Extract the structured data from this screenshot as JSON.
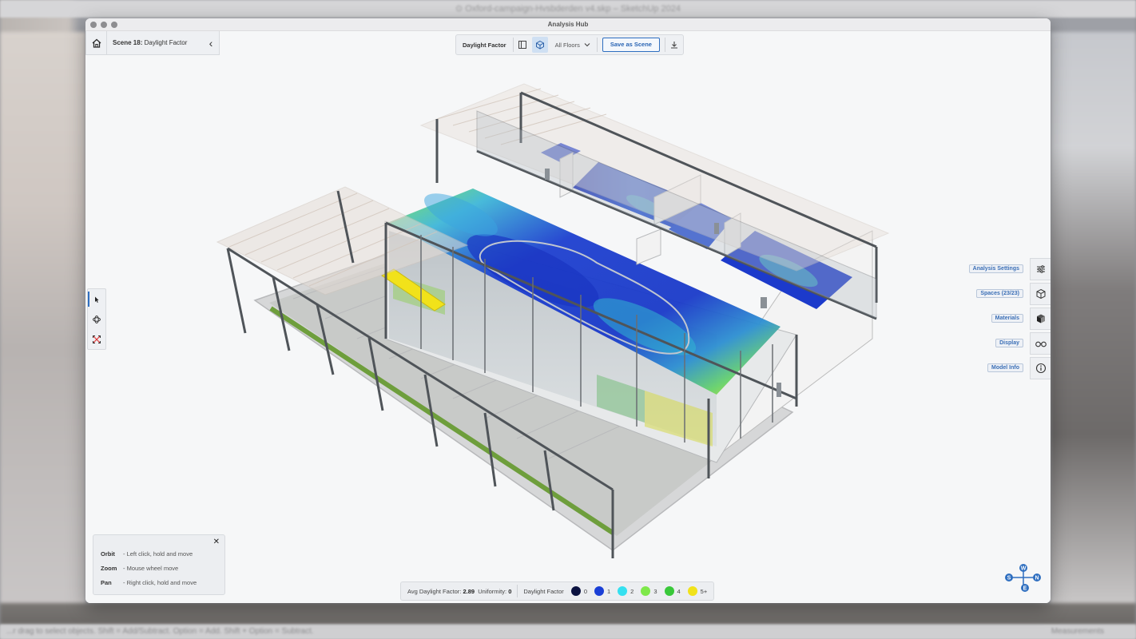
{
  "host": {
    "title": "⊙ Oxford-campaign-Hvsbderden v4.skp – SketchUp 2024",
    "status_left": "...r drag to select objects. Shift = Add/Subtract. Option = Add. Shift + Option = Subtract.",
    "status_right": "Measurements"
  },
  "window": {
    "title": "Analysis Hub"
  },
  "scene": {
    "prefix": "Scene 18:",
    "name": "Daylight Factor"
  },
  "toolbar": {
    "label": "Daylight Factor",
    "floors": "All Floors",
    "save_label": "Save as Scene"
  },
  "left_tools": [
    "select-tool",
    "orbit-tool",
    "zoom-extents-tool"
  ],
  "right_panel": {
    "items": [
      {
        "label": "Analysis Settings",
        "icon": "sliders-icon"
      },
      {
        "label": "Spaces (23/23)",
        "icon": "cube-outline-icon"
      },
      {
        "label": "Materials",
        "icon": "cube-solid-icon"
      },
      {
        "label": "Display",
        "icon": "glasses-icon"
      },
      {
        "label": "Model Info",
        "icon": "info-icon"
      }
    ]
  },
  "help": {
    "rows": [
      {
        "key": "Orbit",
        "desc": "- Left click, hold and move"
      },
      {
        "key": "Zoom",
        "desc": "- Mouse wheel move"
      },
      {
        "key": "Pan",
        "desc": "- Right click, hold and move"
      }
    ]
  },
  "stats": {
    "avg_label": "Avg Daylight Factor:",
    "avg_value": "2.89",
    "uniformity_label": "Uniformity:",
    "uniformity_value": "0",
    "legend_title": "Daylight Factor",
    "legend": [
      {
        "label": "0",
        "color": "#0b1240"
      },
      {
        "label": "1",
        "color": "#1a3fd6"
      },
      {
        "label": "2",
        "color": "#35e0f0"
      },
      {
        "label": "3",
        "color": "#7ee84a"
      },
      {
        "label": "4",
        "color": "#39c83a"
      },
      {
        "label": "5+",
        "color": "#f1e21a"
      }
    ]
  },
  "compass": {
    "n": "N",
    "s": "S",
    "e": "E",
    "w": "W"
  }
}
